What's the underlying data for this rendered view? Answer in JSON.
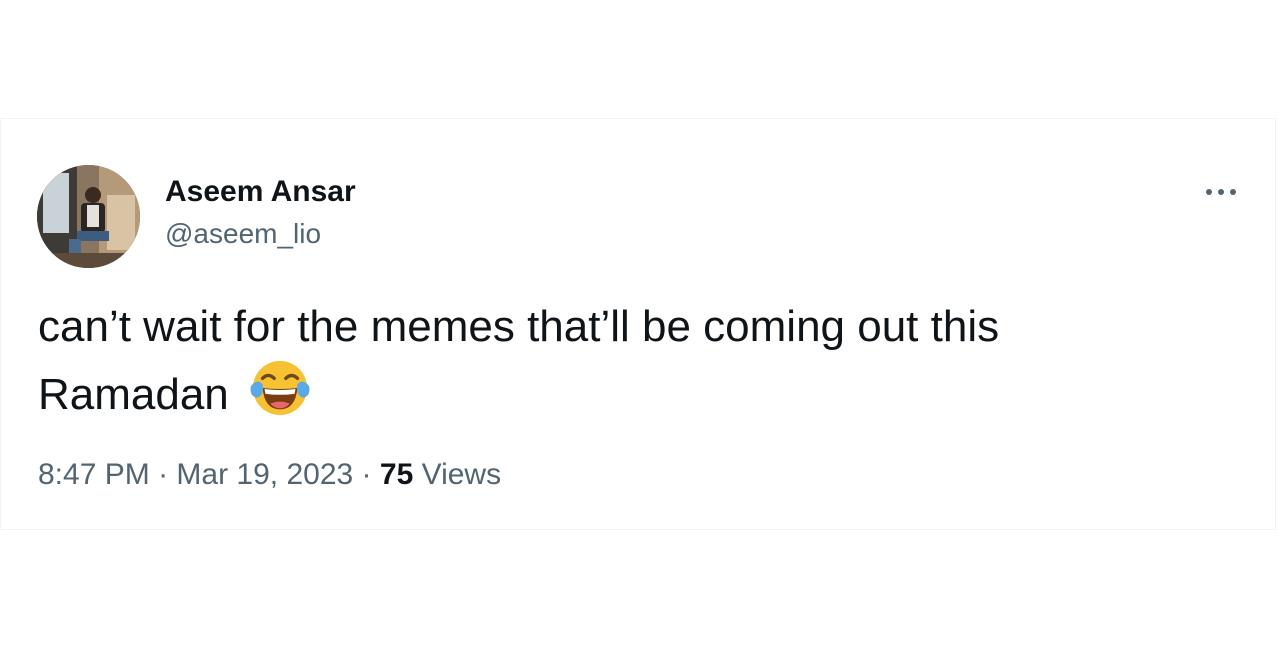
{
  "tweet": {
    "author": {
      "display_name": "Aseem Ansar",
      "handle": "@aseem_lio"
    },
    "text_line1": "can’t wait for the memes that’ll be coming out this",
    "text_line2": "Ramadan",
    "emoji": "face-with-tears-of-joy",
    "time": "8:47 PM",
    "separator": "·",
    "date": "Mar 19, 2023",
    "views_count": "75",
    "views_label": "Views"
  },
  "icons": {
    "more": "more-horizontal-icon"
  },
  "colors": {
    "primary_text": "#0f1419",
    "secondary_text": "#536471",
    "border": "#eff3f4",
    "emoji_yellow": "#f6c234",
    "tear_blue": "#5aa8e6"
  }
}
